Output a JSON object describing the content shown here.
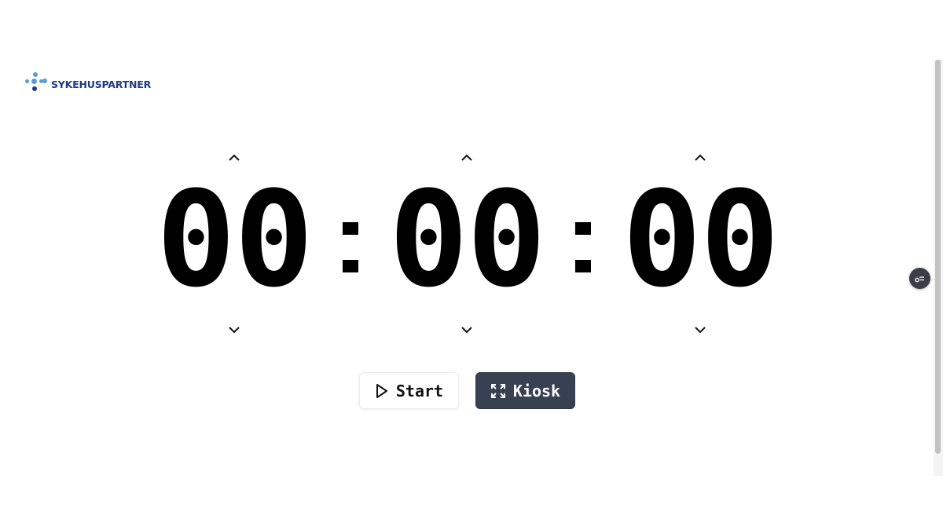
{
  "logo": {
    "text": "SYKEHUSPARTNER",
    "colors": {
      "light": "#5b9bd5",
      "dark": "#1d3a8a"
    }
  },
  "timer": {
    "hours": "00",
    "minutes": "00",
    "seconds": "00",
    "separator_icon": "colon-separator"
  },
  "controls": {
    "start_label": "Start",
    "start_icon": "play-icon",
    "kiosk_label": "Kiosk",
    "kiosk_icon": "expand-arrows-icon"
  },
  "fab": {
    "icon": "settings-toggle-icon"
  },
  "colors": {
    "kiosk_bg": "#374151",
    "fab_bg": "#3b3f45",
    "digits": "#000000"
  }
}
